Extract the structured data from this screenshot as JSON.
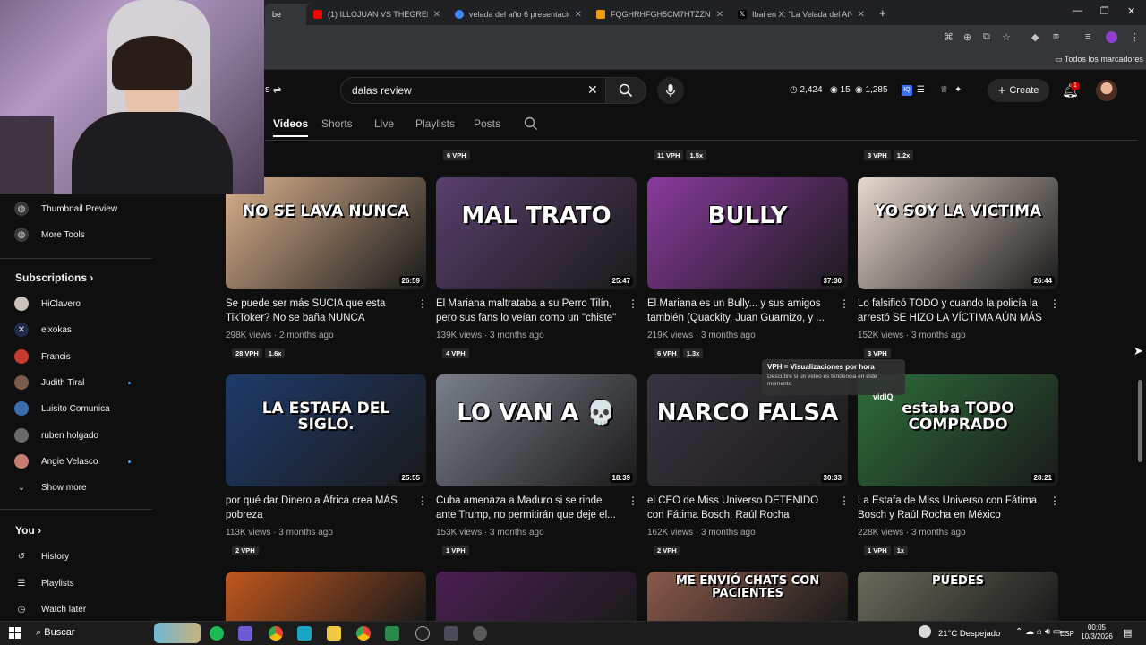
{
  "browser": {
    "tabs": [
      {
        "title": "be",
        "color": "#ff0000"
      },
      {
        "title": "(1) ILLOJUAN VS THEGREFG | C",
        "color": "#ff0000"
      },
      {
        "title": "velada del año 6 presentacion -",
        "color": "#4285f4"
      },
      {
        "title": "FQGHRHFGH5CM7HTZZNKSBI",
        "color": "#f29900"
      },
      {
        "title": "Ibai en X: \"La Velada del Año V",
        "color": "#000000"
      }
    ],
    "bookmarks_label": "Todos los marcadores"
  },
  "youtube": {
    "search_query": "dalas review",
    "header_prefix": "s",
    "stats": {
      "a": "2,424",
      "b": "15",
      "c": "1,285"
    },
    "create_label": "Create",
    "notif_count": "1",
    "nav_tabs": [
      "Videos",
      "Shorts",
      "Live",
      "Playlists",
      "Posts"
    ],
    "top_row_vph": [
      {
        "vph": "6 VPH",
        "mult": ""
      },
      {
        "vph": "11 VPH",
        "mult": "1.5x"
      },
      {
        "vph": "3 VPH",
        "mult": "1.2x"
      }
    ]
  },
  "sidebar": {
    "tools": [
      "Thumbnail Preview",
      "More Tools"
    ],
    "subscriptions_label": "Subscriptions",
    "subscriptions": [
      {
        "name": "HiClavero",
        "dot": false,
        "color": "#c9c3ba"
      },
      {
        "name": "elxokas",
        "dot": false,
        "color": "#1e2a4a"
      },
      {
        "name": "Francis",
        "dot": false,
        "color": "#c83a2c"
      },
      {
        "name": "Judith Tiral",
        "dot": true,
        "color": "#7b5b4a"
      },
      {
        "name": "Luisito Comunica",
        "dot": false,
        "color": "#3a6fb0"
      },
      {
        "name": "ruben holgado",
        "dot": false,
        "color": "#6a6a6a"
      },
      {
        "name": "Angie Velasco",
        "dot": true,
        "color": "#c47d6e"
      }
    ],
    "show_more": "Show more",
    "you_label": "You",
    "you_items": [
      "History",
      "Playlists",
      "Watch later"
    ]
  },
  "videos": [
    {
      "title": "Se puede ser más SUCIA que esta TikToker? No se baña NUNCA",
      "views": "298K views",
      "age": "2 months ago",
      "vph": "28 VPH",
      "mult": "1.6x",
      "duration": "26:59",
      "thumb_text": "NO SE LAVA NUNCA",
      "bg": "#d9b08c"
    },
    {
      "title": "El Mariana maltrataba a su Perro Tilín, pero sus fans lo veían como un \"chiste\"",
      "views": "139K views",
      "age": "3 months ago",
      "vph": "4 VPH",
      "mult": "",
      "duration": "25:47",
      "thumb_text": "MAL TRATO",
      "bg": "#5a3f6e"
    },
    {
      "title": "El Mariana es un Bully... y sus amigos también (Quackity, Juan Guarnizo, y ...",
      "views": "219K views",
      "age": "3 months ago",
      "vph": "6 VPH",
      "mult": "1.3x",
      "duration": "37:30",
      "thumb_text": "BULLY",
      "bg": "#8a3a9e"
    },
    {
      "title": "Lo falsificó TODO y cuando la policía la arrestó SE HIZO LA VÍCTIMA AÚN MÁS",
      "views": "152K views",
      "age": "3 months ago",
      "vph": "3 VPH",
      "mult": "",
      "duration": "26:44",
      "thumb_text": "YO SOY LA VICTIMA",
      "bg": "#e8d7cc"
    },
    {
      "title": "por qué dar Dinero a África crea MÁS pobreza",
      "views": "113K views",
      "age": "3 months ago",
      "vph": "2 VPH",
      "mult": "",
      "duration": "25:55",
      "thumb_text": "LA ESTAFA DEL SIGLO.",
      "bg": "#1e3b6b"
    },
    {
      "title": "Cuba amenaza a Maduro si se rinde ante Trump, no permitirán que deje el...",
      "views": "153K views",
      "age": "3 months ago",
      "vph": "1 VPH",
      "mult": "",
      "duration": "18:39",
      "thumb_text": "LO VAN A 💀",
      "bg": "#7a7f8a"
    },
    {
      "title": "el CEO de Miss Universo DETENIDO con Fátima Bosch: Raúl Rocha",
      "views": "162K views",
      "age": "3 months ago",
      "vph": "2 VPH",
      "mult": "",
      "duration": "30:33",
      "thumb_text": "NARCO FALSA",
      "bg": "#3a3440"
    },
    {
      "title": "La Estafa de Miss Universo con Fátima Bosch y Raúl Rocha en México",
      "views": "228K views",
      "age": "3 months ago",
      "vph": "1 VPH",
      "mult": "1x",
      "duration": "28:21",
      "thumb_text": "estaba TODO COMPRADO",
      "bg": "#2e6e3a"
    }
  ],
  "bottom_row": [
    {
      "thumb_text": "",
      "bg": "#c0581e"
    },
    {
      "thumb_text": "",
      "bg": "#4a1f52"
    },
    {
      "thumb_text": "ME ENVIÓ CHATS CON PACIENTES",
      "bg": "#8a5a4a"
    },
    {
      "thumb_text": "PUEDES",
      "bg": "#6a6a5a"
    }
  ],
  "tooltip": {
    "title": "VPH = Visualizaciones por hora",
    "body": "Descubre si un video es tendencia en este momento",
    "brand": "vidIQ"
  },
  "taskbar": {
    "search": "Buscar",
    "weather": "21°C  Despejado",
    "lang": "ESP",
    "time": "00:05",
    "date": "10/3/2026"
  }
}
